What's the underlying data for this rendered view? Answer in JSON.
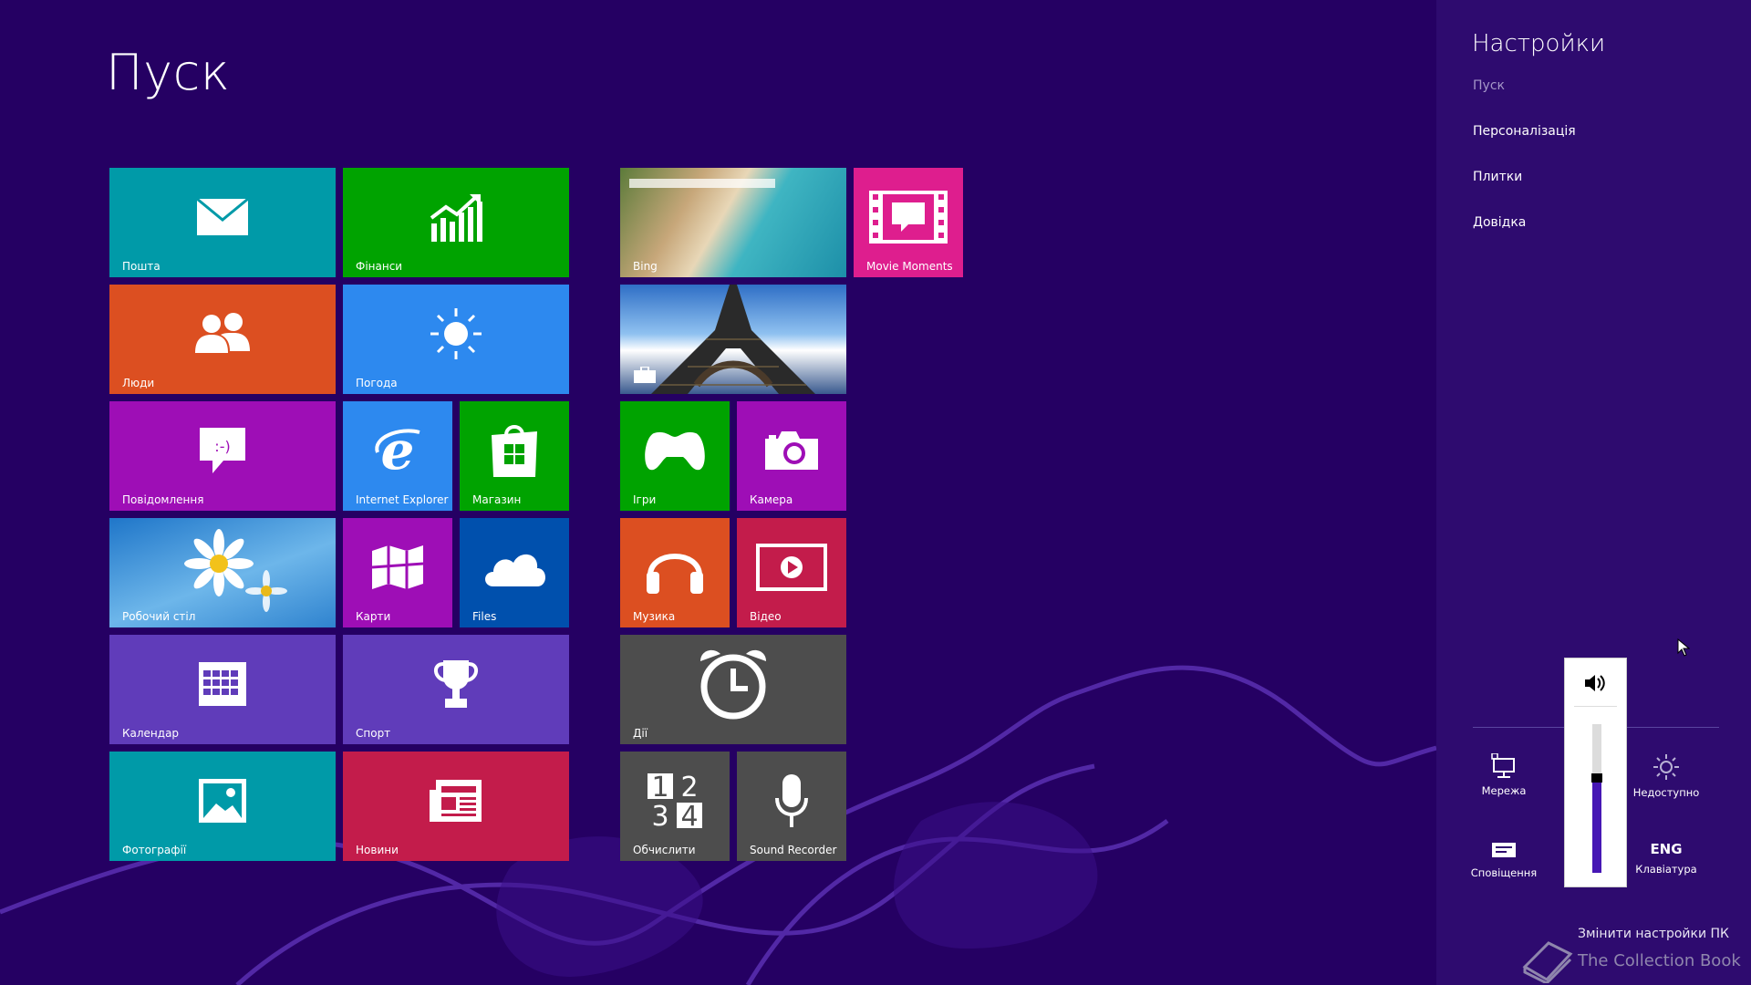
{
  "start": {
    "title": "Пуск"
  },
  "tiles": {
    "mail": "Пошта",
    "finance": "Фінанси",
    "people": "Люди",
    "weather": "Погода",
    "messaging": "Повідомлення",
    "ie": "Internet Explorer",
    "store": "Магазин",
    "desktop": "Робочий стіл",
    "maps": "Карти",
    "files": "Files",
    "calendar": "Календар",
    "sport": "Спорт",
    "photos": "Фотографії",
    "news": "Новини",
    "bing": "Bing",
    "movie": "Movie Moments",
    "games": "Ігри",
    "camera": "Камера",
    "music": "Музика",
    "video": "Відео",
    "alarms": "Дії",
    "calculator": "Обчислити",
    "recorder": "Sound Recorder"
  },
  "charm": {
    "title": "Настройки",
    "items": [
      "Пуск",
      "Персоналізація",
      "Плитки",
      "Довідка"
    ],
    "quick": {
      "network": "Мережа",
      "unavailable": "Недоступно",
      "notifications": "Сповіщення",
      "keyboard": "Клавіатура",
      "lang": "ENG"
    },
    "volume_level": 0.62,
    "change_pc": "Змінити настройки ПК"
  },
  "watermark": "The Collection Book",
  "colors": {
    "background": "#250063",
    "charm_bg": "#2e0b6f",
    "teal": "#009aa8",
    "green": "#00a300",
    "orange": "#dc4f21",
    "blue": "#2d89ef",
    "purple": "#9e0eb6",
    "violet": "#603cba",
    "crimson": "#c31c4b",
    "magenta": "#de1e8e",
    "gray": "#4d4d4d",
    "darkblue": "#0050ad"
  }
}
